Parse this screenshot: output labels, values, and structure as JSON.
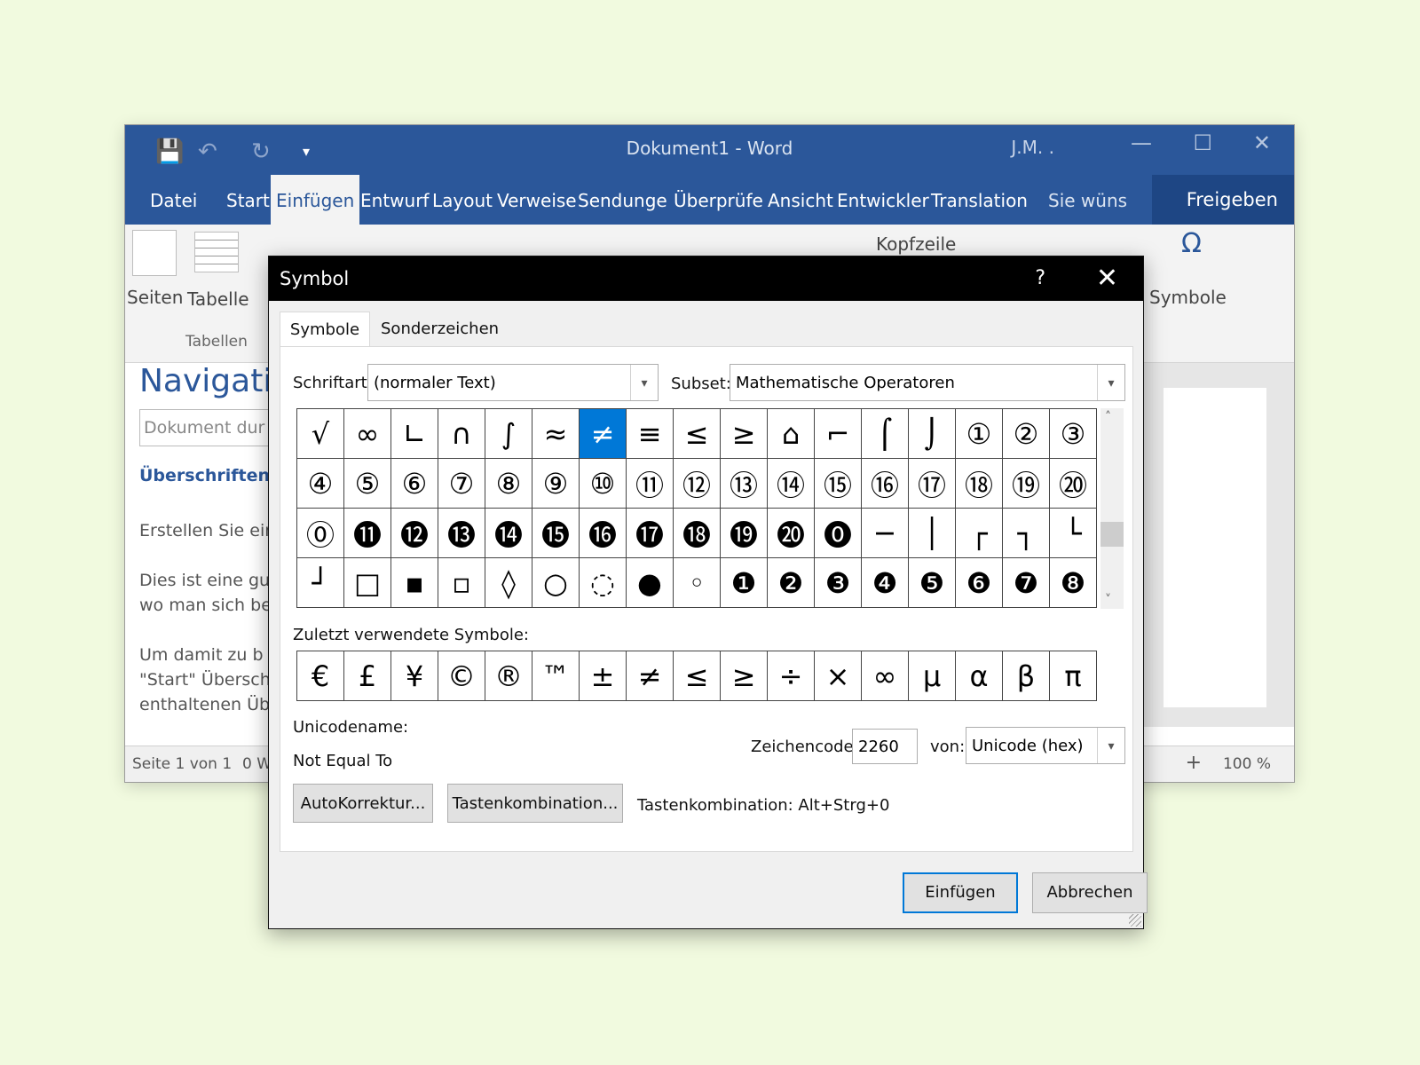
{
  "window": {
    "doc_title": "Dokument1 - Word",
    "user": "J.M. .",
    "minimize": "—",
    "maximize": "☐",
    "close": "✕"
  },
  "qat": {
    "save": "💾",
    "undo": "↶",
    "redo": "↻",
    "customize": "▾"
  },
  "tabs": [
    {
      "label": "Datei"
    },
    {
      "label": "Start"
    },
    {
      "label": "Einfügen"
    },
    {
      "label": "Entwurf"
    },
    {
      "label": "Layout"
    },
    {
      "label": "Verweise"
    },
    {
      "label": "Sendunge"
    },
    {
      "label": "Überprüfe"
    },
    {
      "label": "Ansicht"
    },
    {
      "label": "Entwickler"
    },
    {
      "label": "Translation"
    },
    {
      "label": "Sie wüns"
    }
  ],
  "share_label": "Freigeben",
  "ribbon": {
    "seiten": "Seiten",
    "tabelle": "Tabelle",
    "tabellen_group": "Tabellen",
    "kopfzeile": "Kopfzeile",
    "symbole": "Symbole"
  },
  "nav": {
    "title": "Navigati",
    "search_placeholder": "Dokument dur",
    "headings_link": "Überschriften",
    "p1": "Erstellen Sie ein",
    "p2a": "Dies ist eine gu",
    "p2b": "wo man sich be",
    "p3a": "Um damit zu b",
    "p3b": "\"Start\" Übersch",
    "p3c": "enthaltenen Üb"
  },
  "status": {
    "page": "Seite 1 von 1",
    "words": "0 W",
    "zoom": "100 %"
  },
  "dialog": {
    "title": "Symbol",
    "help": "?",
    "close": "✕",
    "tab_symbols": "Symbole",
    "tab_special": "Sonderzeichen",
    "font_label": "Schriftart:",
    "font_value": "(normaler Text)",
    "subset_label": "Subset:",
    "subset_value": "Mathematische Operatoren",
    "symbols": [
      "√",
      "∞",
      "∟",
      "∩",
      "∫",
      "≈",
      "≠",
      "≡",
      "≤",
      "≥",
      "⌂",
      "⌐",
      "⌠",
      "⌡",
      "①",
      "②",
      "③",
      "④",
      "⑤",
      "⑥",
      "⑦",
      "⑧",
      "⑨",
      "⑩",
      "⑪",
      "⑫",
      "⑬",
      "⑭",
      "⑮",
      "⑯",
      "⑰",
      "⑱",
      "⑲",
      "⑳",
      "⓪",
      "⓫",
      "⓬",
      "⓭",
      "⓮",
      "⓯",
      "⓰",
      "⓱",
      "⓲",
      "⓳",
      "⓴",
      "⓿",
      "─",
      "│",
      "┌",
      "┐",
      "└",
      "┘",
      "□",
      "▪",
      "▫",
      "◊",
      "○",
      "◌",
      "●",
      "◦",
      "❶",
      "❷",
      "❸",
      "❹",
      "❺",
      "❻",
      "❼",
      "❽"
    ],
    "selected_index": 6,
    "recent_label": "Zuletzt verwendete Symbole:",
    "recent": [
      "€",
      "£",
      "¥",
      "©",
      "®",
      "™",
      "±",
      "≠",
      "≤",
      "≥",
      "÷",
      "×",
      "∞",
      "µ",
      "α",
      "β",
      "π"
    ],
    "unicode_name_label": "Unicodename:",
    "unicode_name": "Not Equal To",
    "charcode_label": "Zeichencode:",
    "charcode": "2260",
    "from_label": "von:",
    "from_value": "Unicode (hex)",
    "autocorrect": "AutoKorrektur...",
    "shortcut_button": "Tastenkombination...",
    "shortcut_text": "Tastenkombination: Alt+Strg+0",
    "insert": "Einfügen",
    "cancel": "Abbrechen"
  }
}
